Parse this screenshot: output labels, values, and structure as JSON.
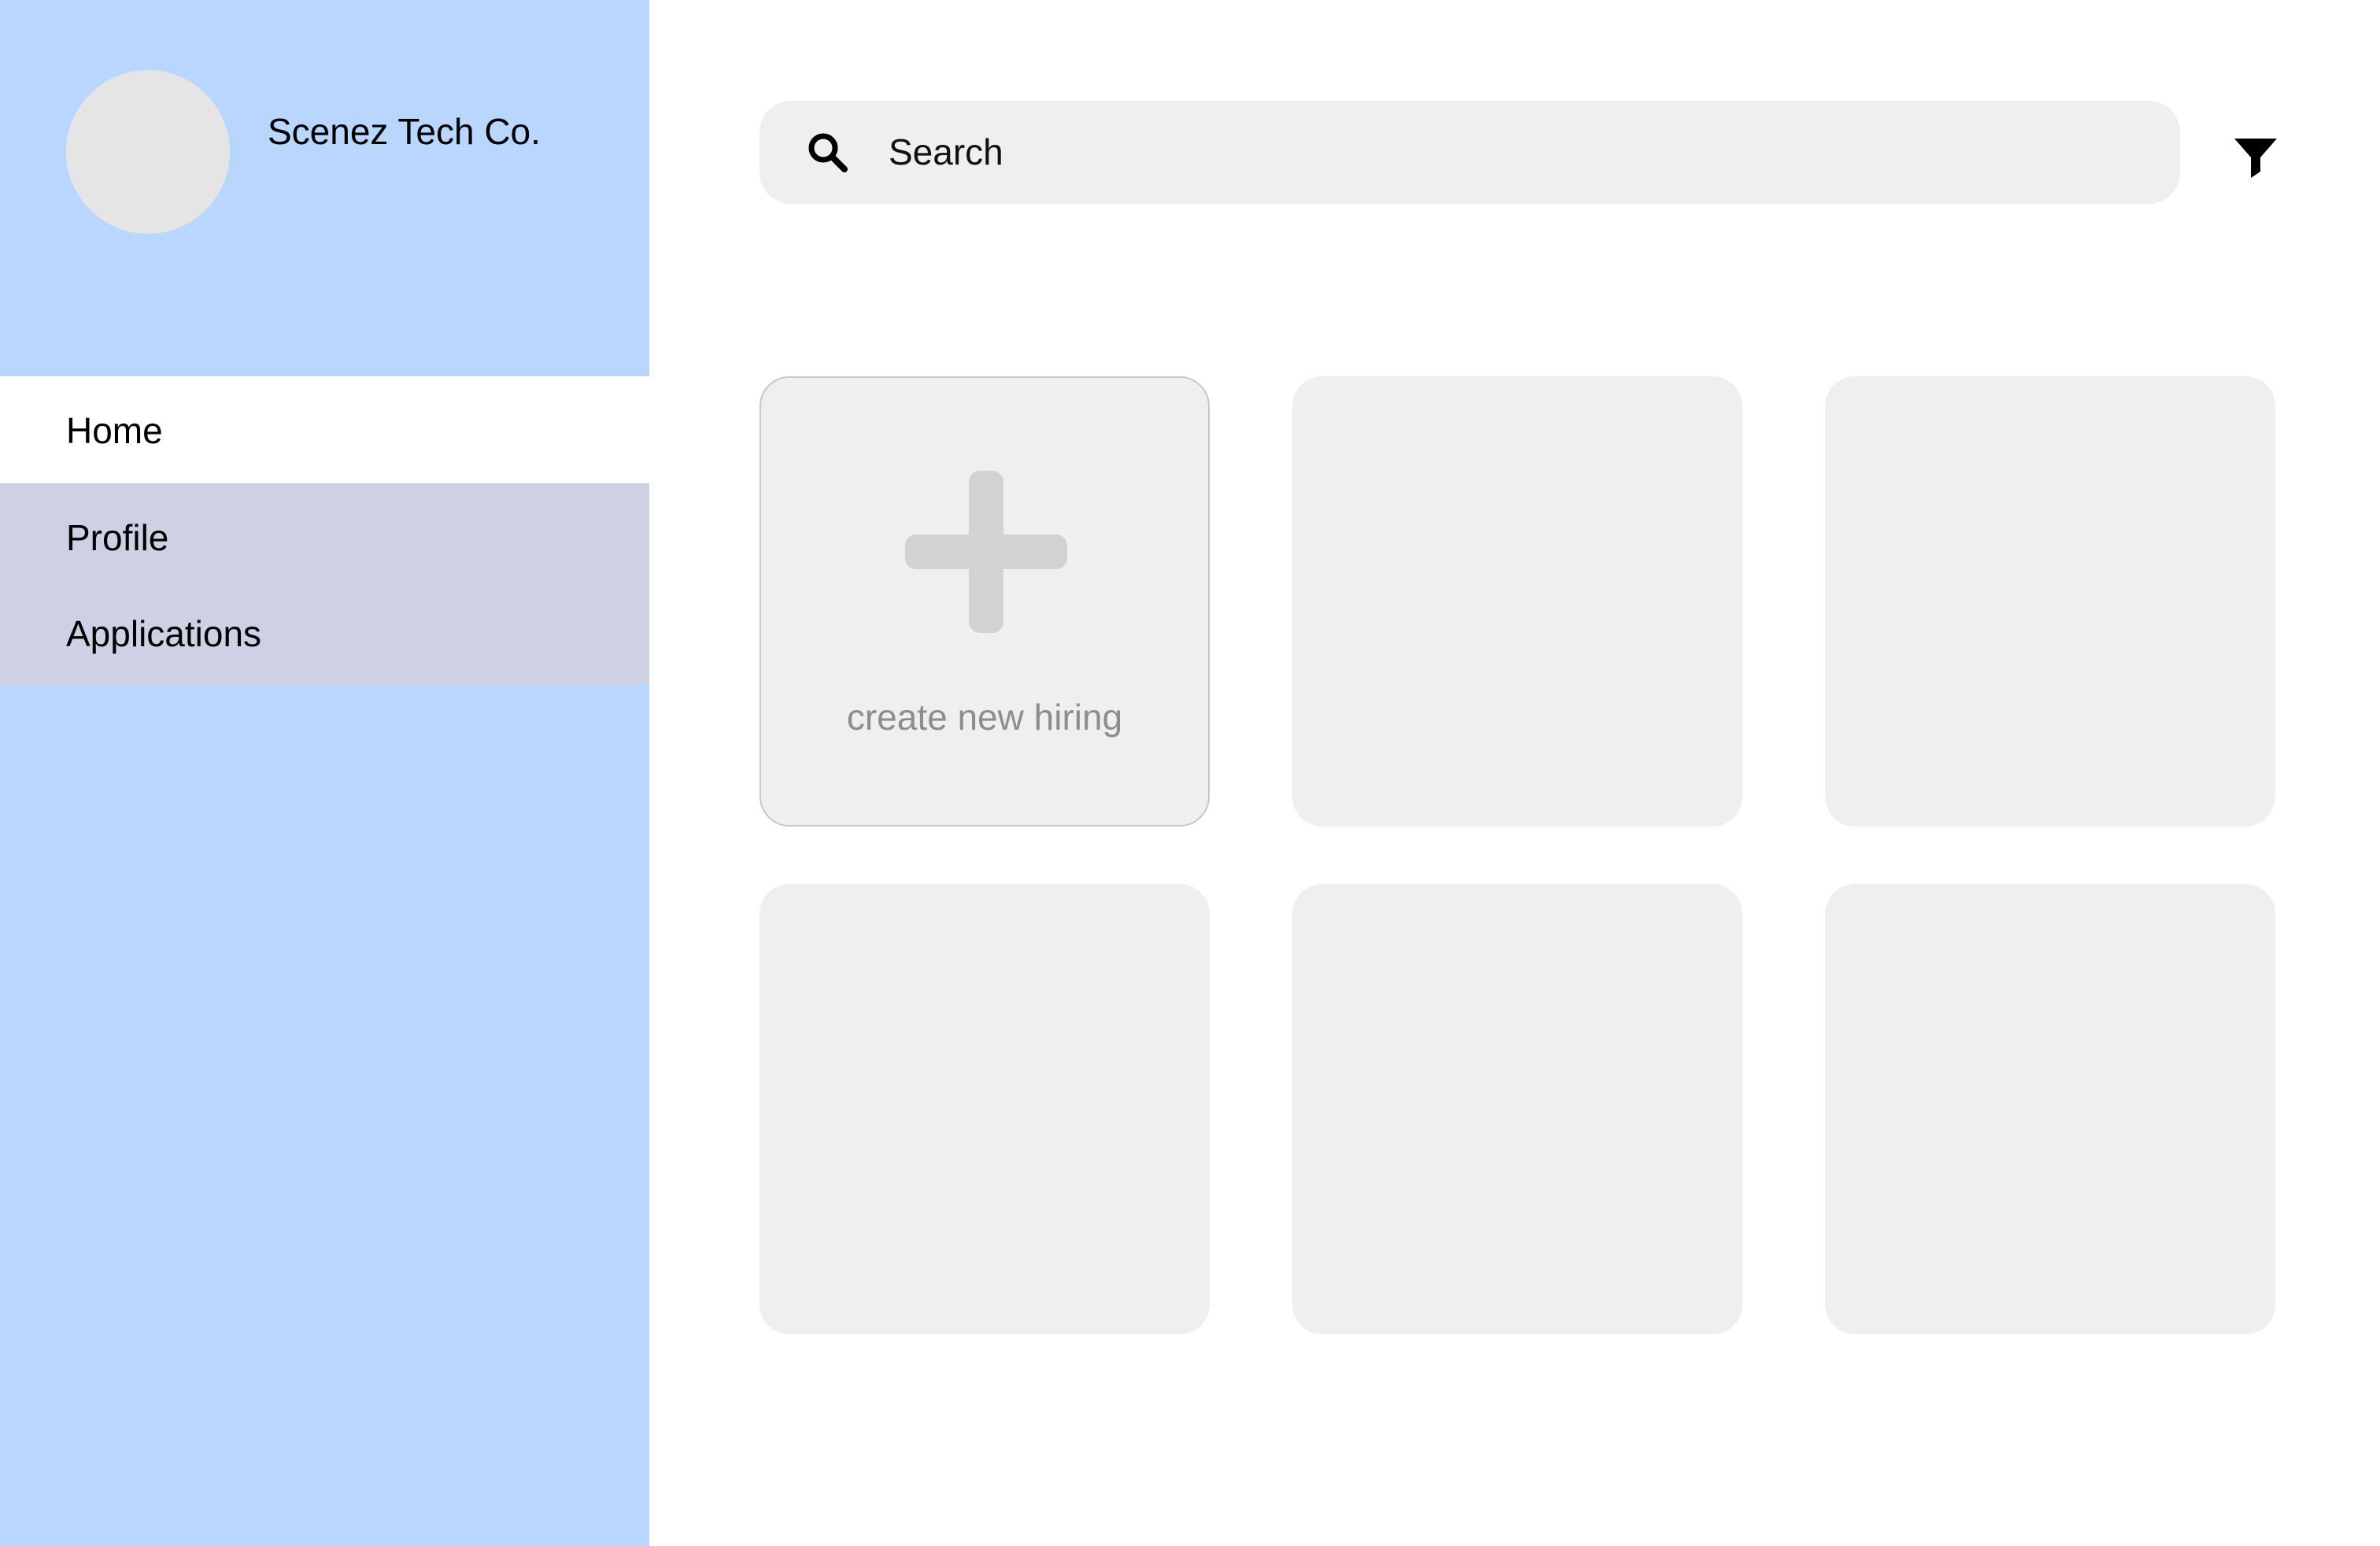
{
  "sidebar": {
    "company_name": "Scenez Tech Co.",
    "nav": {
      "home": "Home",
      "profile": "Profile",
      "applications": "Applications"
    }
  },
  "header": {
    "search": {
      "placeholder": "Search",
      "value": ""
    },
    "icons": {
      "search": "search-icon",
      "filter": "filter-icon"
    }
  },
  "grid": {
    "create_card": {
      "label": "create new hiring",
      "icon": "plus-icon"
    },
    "placeholder_card_count": 5
  },
  "colors": {
    "sidebar_background": "#b9d6ff",
    "nav_active_background": "#ffffff",
    "nav_group_background": "#cdd1e3",
    "card_background": "#efefef",
    "plus_icon": "#d2d2d2",
    "muted_text": "#8d8d8d"
  }
}
